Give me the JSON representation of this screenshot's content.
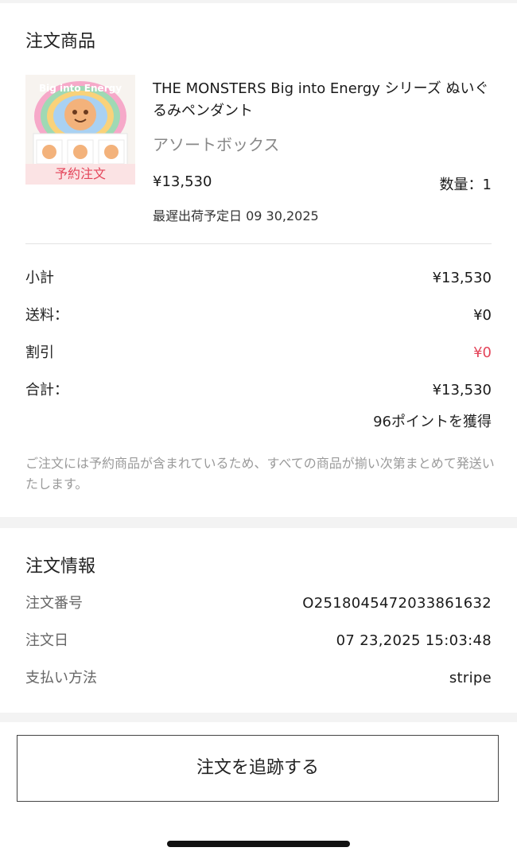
{
  "products_section": {
    "title": "注文商品",
    "item": {
      "name": "THE MONSTERS Big into Energy シリーズ ぬいぐるみペンダント",
      "variant": "アソートボックス",
      "price": "¥13,530",
      "quantity_label": "数量：1",
      "badge": "予約注文",
      "image_brand_text": "Big into Energy",
      "shipping_date": "最遅出荷予定日 09 30,2025"
    },
    "summary": [
      {
        "key": "小計",
        "value": "¥13,530",
        "highlight": false
      },
      {
        "key": "送料：",
        "value": "¥0",
        "highlight": false
      },
      {
        "key": "割引",
        "value": "¥0",
        "highlight": true
      },
      {
        "key": "合計：",
        "value": "¥13,530",
        "highlight": false
      }
    ],
    "points": "96ポイントを獲得",
    "note": "ご注文には予約商品が含まれているため、すべての商品が揃い次第まとめて発送いたします。"
  },
  "info_section": {
    "title": "注文情報",
    "rows": [
      {
        "key": "注文番号",
        "value": "O2518045472033861632"
      },
      {
        "key": "注文日",
        "value": "07 23,2025 15:03:48"
      },
      {
        "key": "支払い方法",
        "value": "stripe"
      }
    ]
  },
  "actions": {
    "track_label": "注文を追跡する"
  },
  "colors": {
    "accent_red": "#e4455a",
    "badge_bg": "#fbe3e4",
    "muted_text": "#9a9a9a",
    "page_bg": "#f3f3f3"
  }
}
